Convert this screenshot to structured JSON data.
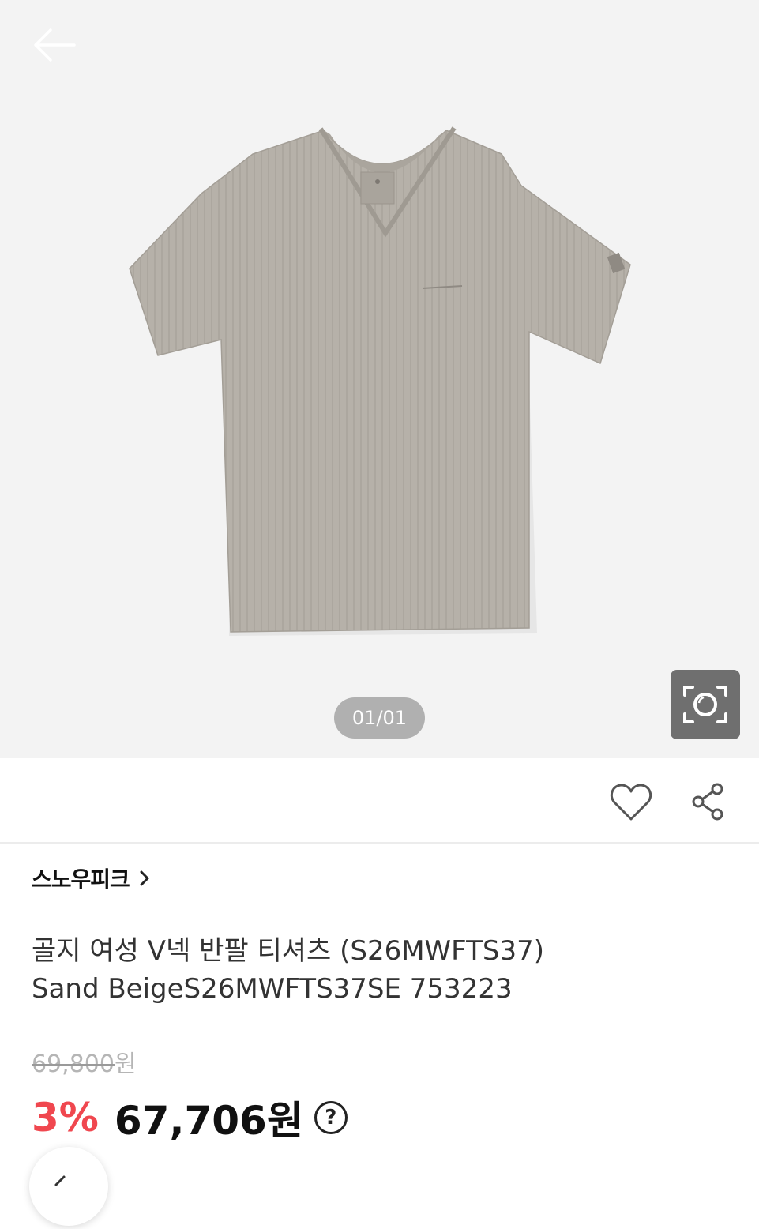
{
  "gallery": {
    "counter": "01/01",
    "image_alt": "Sand Beige V-neck short sleeve t-shirt"
  },
  "icons": {
    "back": "arrow-left-icon",
    "lens": "camera-search-icon",
    "wishlist": "heart-icon",
    "share": "share-icon",
    "brand_chevron": "chevron-right-icon",
    "help": "question-circle-icon",
    "fab": "chevron-icon"
  },
  "product": {
    "brand": "스노우피크",
    "title_line1": "골지 여성 V넥 반팔 티셔츠 (S26MWFTS37)",
    "title_line2": "Sand BeigeS26MWFTS37SE 753223",
    "original_price": "69,800",
    "original_currency": "원",
    "discount": "3%",
    "sale_price": "67,706원",
    "help_label": "?"
  },
  "colors": {
    "discount": "#f0474f",
    "hero_bg": "#f3f3f3",
    "shirt": "#b6b1a9"
  }
}
